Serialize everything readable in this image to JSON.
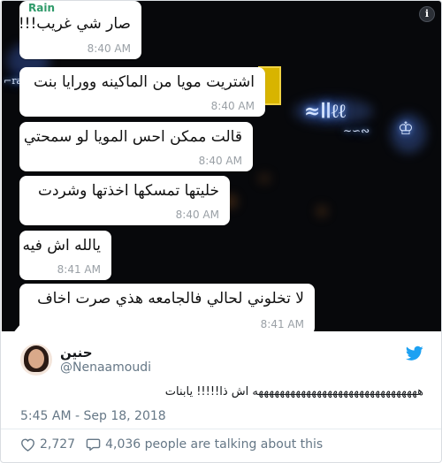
{
  "chat": {
    "sender": "Rain",
    "messages": [
      {
        "text": "صار شي غريب!!!",
        "time": "8:40 AM"
      },
      {
        "text": "اشتريت مويا من الماكينه وورايا بنت",
        "time": "8:40 AM"
      },
      {
        "text": "قالت ممكن احس المويا لو سمحتي",
        "time": "8:40 AM"
      },
      {
        "text": "خليتها تمسكها اخذتها وشردت",
        "time": "8:40 AM"
      },
      {
        "text": "يالله اش فيه",
        "time": "8:41 AM"
      },
      {
        "text": "لا تخلوني لحالي فالجامعه هذي صرت اخاف",
        "time": "8:41 AM"
      }
    ],
    "info_icon": "info-icon",
    "background_color": "#07080b",
    "bubble_color": "#ffffff"
  },
  "tweet": {
    "display_name": "حنين",
    "handle": "@Nenaamoudi",
    "text": "هههههههههههههههههههههههههههههههه اش ذا!!!!! يابنات",
    "timestamp": "5:45 AM - Sep 18, 2018",
    "likes": "2,727",
    "talking": "4,036 people are talking about this",
    "icons": {
      "logo": "twitter-bird-icon",
      "like": "heart-icon",
      "reply": "speech-bubble-icon"
    },
    "accent_color": "#1da1f2"
  }
}
